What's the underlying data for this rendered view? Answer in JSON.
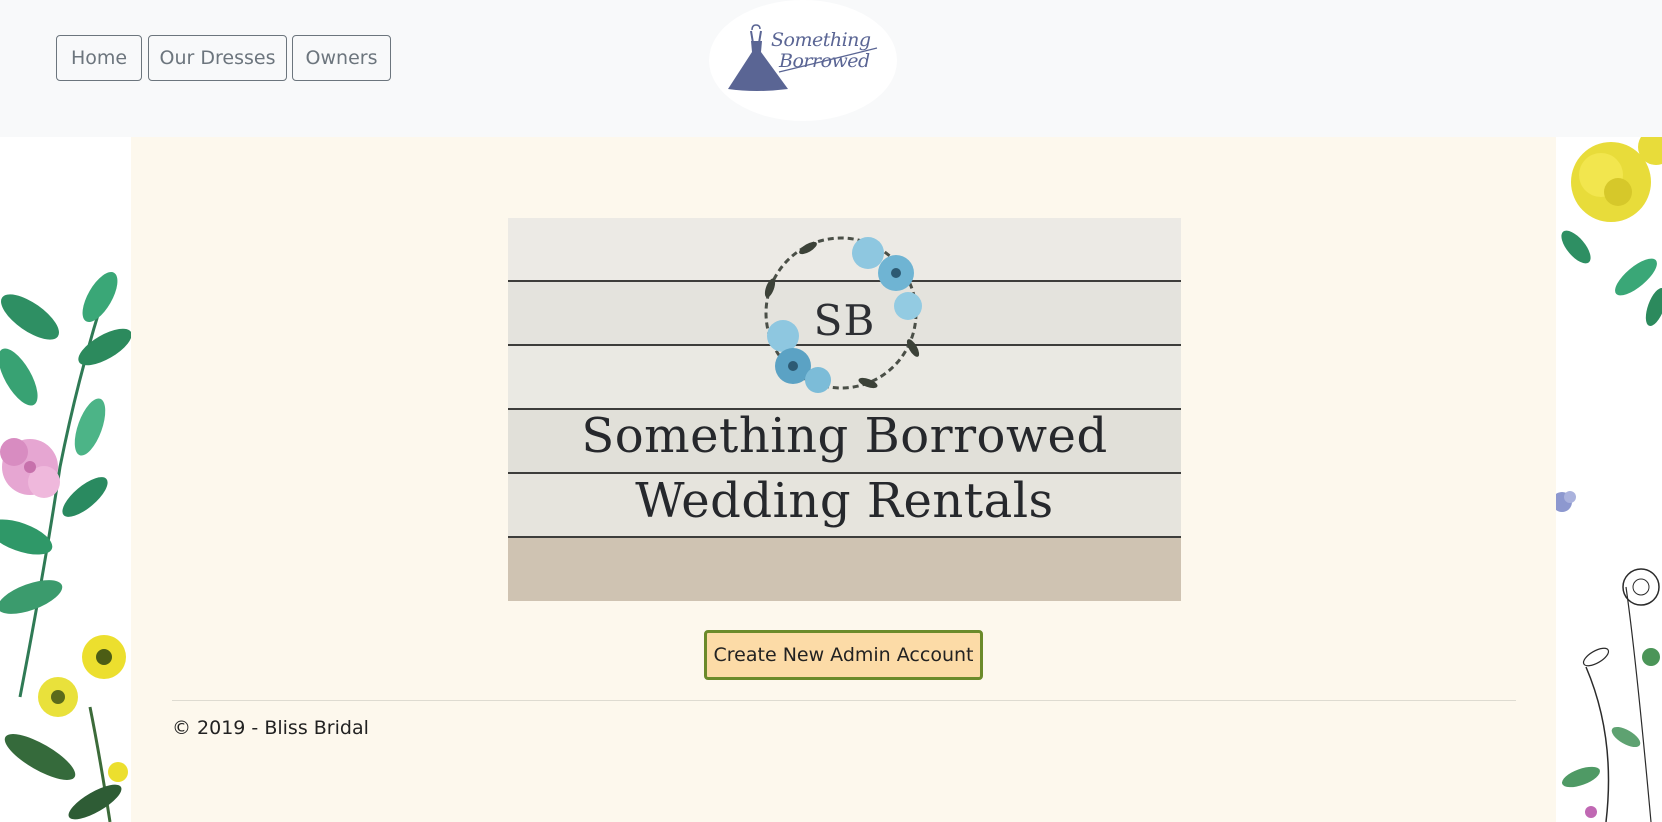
{
  "nav": {
    "items": [
      {
        "label": "Home"
      },
      {
        "label": "Our Dresses"
      },
      {
        "label": "Owners"
      }
    ],
    "logo": {
      "line1": "Something",
      "line2": "Borrowed"
    }
  },
  "hero": {
    "monogram": "SB",
    "line1": "Something Borrowed",
    "line2": "Wedding Rentals"
  },
  "main": {
    "cta_label": "Create New Admin Account"
  },
  "footer": {
    "text": "© 2019 - Bliss Bridal"
  },
  "colors": {
    "navbar_bg": "#f8f9fa",
    "content_bg": "#fdf8ed",
    "cta_bg": "#fcdba7",
    "cta_border": "#6b8a2a",
    "logo": "#5a6594"
  },
  "icons": {
    "logo": "dress-icon",
    "wreath": "floral-wreath-icon"
  }
}
